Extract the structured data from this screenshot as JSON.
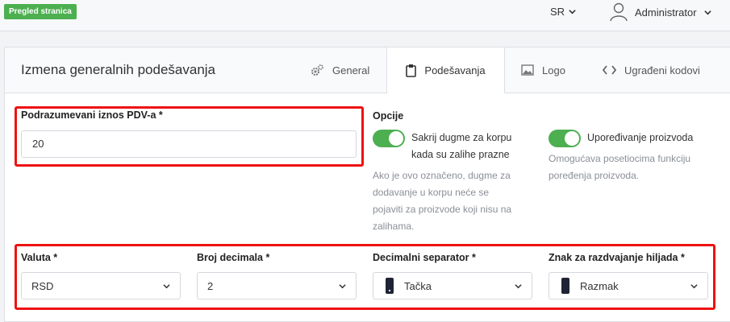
{
  "topbar": {
    "badge": "Pregled stranica",
    "language": "SR",
    "user": "Administrator"
  },
  "panel": {
    "title": "Izmena generalnih podešavanja",
    "tabs": [
      {
        "label": "General",
        "icon": "gears-icon",
        "active": false
      },
      {
        "label": "Podešavanja",
        "icon": "clipboard-icon",
        "active": true
      },
      {
        "label": "Logo",
        "icon": "image-icon",
        "active": false
      },
      {
        "label": "Ugrađeni kodovi",
        "icon": "code-icon",
        "active": false
      }
    ]
  },
  "form": {
    "vat": {
      "label": "Podrazumevani iznos PDV-a *",
      "value": "20"
    },
    "options_title": "Opcije",
    "option1": {
      "label_line1": "Sakrij dugme za korpu",
      "label_line2": "kada su zalihe prazne",
      "checked": true,
      "help": [
        "Ako je ovo označeno, dugme za",
        "dodavanje u korpu neće se",
        "pojaviti za proizvode koji nisu na",
        "zalihama."
      ]
    },
    "option2": {
      "label": "Upoređivanje proizvoda",
      "checked": true,
      "help": [
        "Omogućava posetiocima funkciju",
        "poređenja proizvoda."
      ]
    },
    "currency": {
      "label": "Valuta *",
      "value": "RSD"
    },
    "decimals": {
      "label": "Broj decimala *",
      "value": "2"
    },
    "decimal_sep": {
      "label": "Decimalni separator *",
      "value": "Tačka"
    },
    "thousands_sep": {
      "label": "Znak za razdvajanje hiljada *",
      "value": "Razmak"
    }
  },
  "colors": {
    "accent": "#4caf50",
    "highlight": "#e11111",
    "swatch": "#1e2433"
  }
}
